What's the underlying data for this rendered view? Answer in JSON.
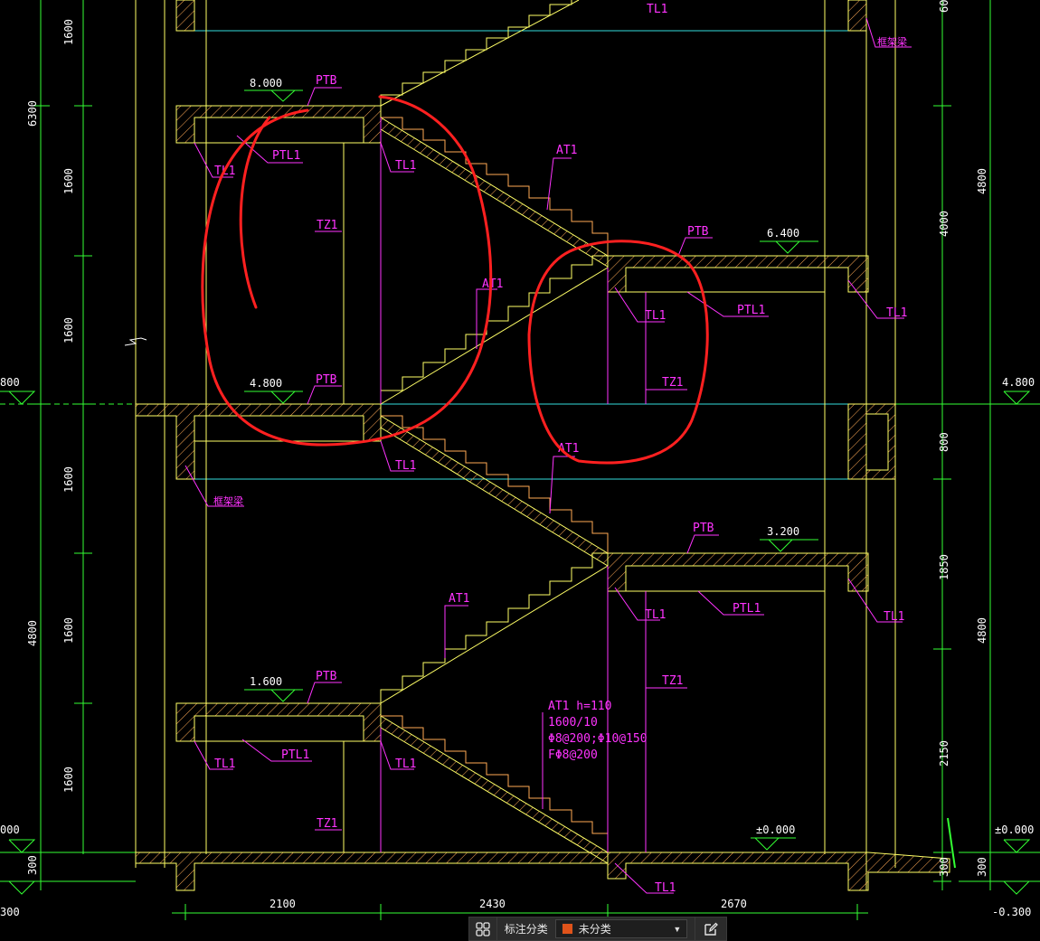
{
  "colors": {
    "wall": "#ffff66",
    "stair": "#ffff66",
    "hatch": "#ffaa55",
    "label": "#ff33ff",
    "dim": "#33ff33",
    "cyan": "#33dddd",
    "markup": "#ff2020",
    "white": "#ffffff",
    "status_swatch": "#e0531a"
  },
  "elevations": {
    "e8000": "8.000",
    "e6400": "6.400",
    "e4800": "4.800",
    "e3200": "3.200",
    "e1600": "1.600",
    "e0000": "±0.000",
    "left_4800_partial": "800",
    "left_0000_partial": "000",
    "left_m0300_partial": "300",
    "right_4800": "4.800",
    "right_0000": "±0.000",
    "right_m0300": "-0.300"
  },
  "labels": {
    "ptb": "PTB",
    "ptl1": "PTL1",
    "tl1": "TL1",
    "tz1": "TZ1",
    "at1": "AT1",
    "beam_note": "框架梁"
  },
  "annotation": {
    "line1": "AT1 h=110",
    "line2": "1600/10",
    "line3": "Φ8@200;Φ10@150",
    "line4": "FΦ8@200"
  },
  "dims_left_outer": {
    "d6300": "6300",
    "d4800": "4800",
    "d300": "300"
  },
  "dims_left_inner": {
    "d1600": "1600"
  },
  "dims_right_inner": {
    "d4000": "4000",
    "d800": "800",
    "d1850": "1850",
    "d2150": "2150",
    "d300": "300",
    "d60": "60"
  },
  "dims_right_outer": {
    "d4800": "4800"
  },
  "dims_bottom": {
    "d2100": "2100",
    "d2430": "2430",
    "d2670": "2670"
  },
  "status_bar": {
    "label": "标注分类",
    "select_value": "未分类",
    "grid_icon": "grid-icon",
    "edit_icon": "edit-icon"
  }
}
